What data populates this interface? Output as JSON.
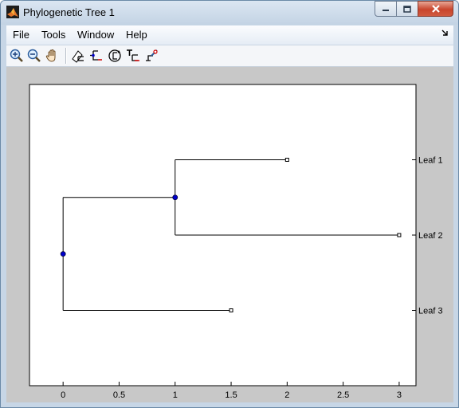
{
  "window": {
    "title": "Phylogenetic Tree 1",
    "app_icon": "matlab-logo-icon",
    "controls": [
      "minimize-icon",
      "maximize-icon",
      "close-icon"
    ]
  },
  "menu": {
    "items": [
      "File",
      "Tools",
      "Window",
      "Help"
    ],
    "dock_icon": "dock-arrow-icon"
  },
  "toolbar": {
    "tools": [
      "zoom-in-icon",
      "zoom-out-icon",
      "pan-hand-icon",
      "inspect-branch-icon",
      "collapse-expand-icon",
      "rotate-branch-icon",
      "rename-node-icon",
      "prune-icon"
    ]
  },
  "chart_data": {
    "type": "dendrogram",
    "title": "",
    "xlim": [
      -0.3,
      3.15
    ],
    "xticks": [
      0,
      0.5,
      1,
      1.5,
      2,
      2.5,
      3
    ],
    "xtick_labels": [
      "0",
      "0.5",
      "1",
      "1.5",
      "2",
      "2.5",
      "3"
    ],
    "leaves": [
      {
        "name": "Leaf 1",
        "distance": 2.0
      },
      {
        "name": "Leaf 2",
        "distance": 3.0
      },
      {
        "name": "Leaf 3",
        "distance": 1.5
      }
    ],
    "branch_nodes": [
      {
        "id": "root",
        "distance": 0.0,
        "children": [
          "node-1",
          "Leaf 3"
        ]
      },
      {
        "id": "node-1",
        "distance": 1.0,
        "children": [
          "Leaf 1",
          "Leaf 2"
        ]
      }
    ],
    "colors": {
      "branch": "#000000",
      "node_fill": "#0000cc",
      "leaf_marker": "#000000",
      "background": "#ffffff"
    }
  }
}
